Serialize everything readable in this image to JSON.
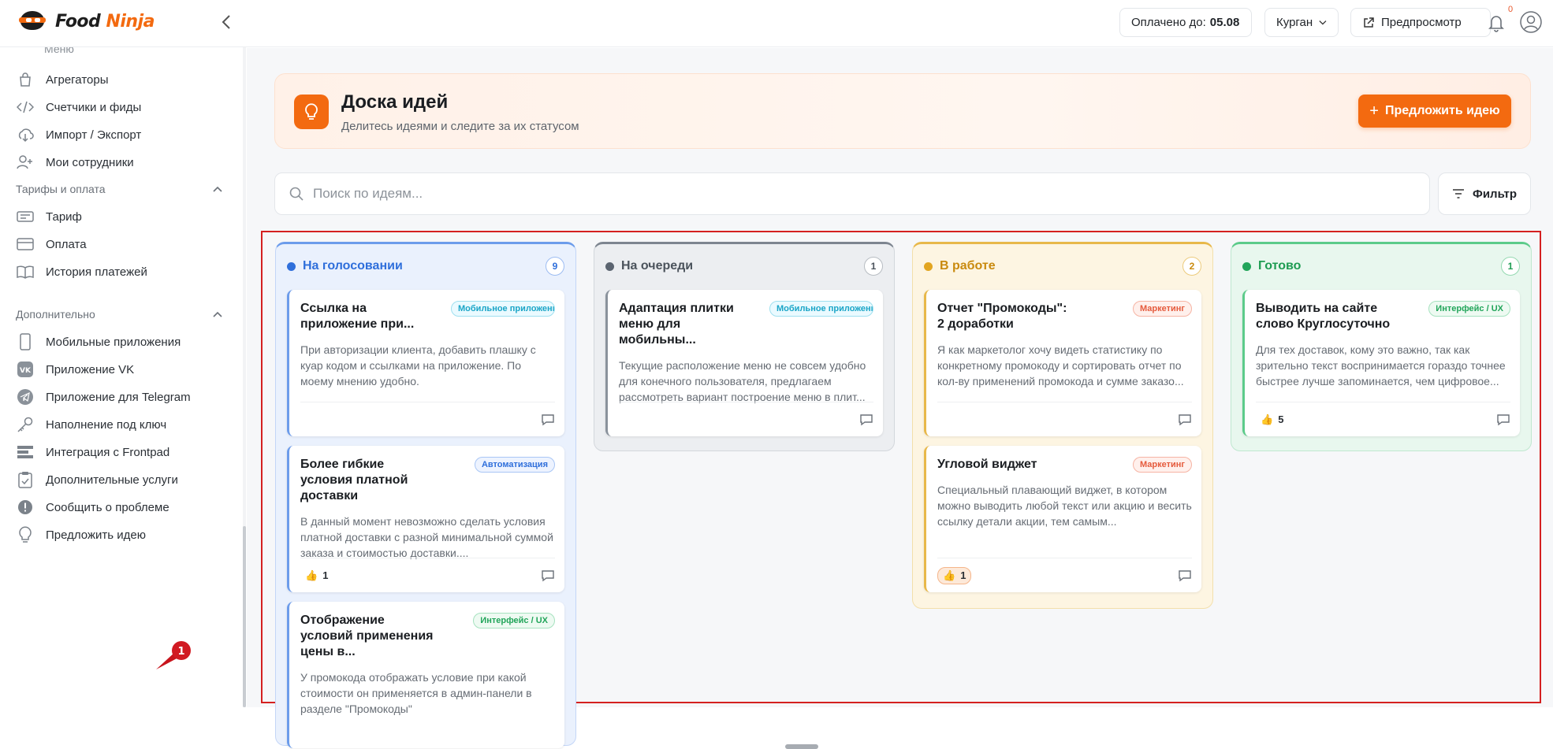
{
  "header": {
    "logo_part1": "Food",
    "logo_part2": "Ninja",
    "paid_label": "Оплачено до:",
    "paid_date": "05.08",
    "city": "Курган",
    "preview_label": "Предпросмотр",
    "notifications_count": "0"
  },
  "sidebar": {
    "cut_item": "Меню",
    "group1": [
      {
        "label": "Агрегаторы",
        "icon": "bag-icon"
      },
      {
        "label": "Счетчики и фиды",
        "icon": "code-icon"
      },
      {
        "label": "Импорт / Экспорт",
        "icon": "cloud-download-icon"
      },
      {
        "label": "Мои сотрудники",
        "icon": "user-plus-icon"
      }
    ],
    "section_tariffs": "Тарифы и оплата",
    "group2": [
      {
        "label": "Тариф",
        "icon": "ticket-icon"
      },
      {
        "label": "Оплата",
        "icon": "card-icon"
      },
      {
        "label": "История платежей",
        "icon": "book-icon"
      }
    ],
    "section_extra": "Дополнительно",
    "group3": [
      {
        "label": "Мобильные приложения",
        "icon": "phone-icon"
      },
      {
        "label": "Приложение VK",
        "icon": "vk-icon"
      },
      {
        "label": "Приложение для Telegram",
        "icon": "telegram-icon"
      },
      {
        "label": "Наполнение под ключ",
        "icon": "key-icon"
      },
      {
        "label": "Интеграция с Frontpad",
        "icon": "frontpad-icon"
      },
      {
        "label": "Дополнительные услуги",
        "icon": "clipboard-icon"
      },
      {
        "label": "Сообщить о проблеме",
        "icon": "alert-icon"
      },
      {
        "label": "Предложить идею",
        "icon": "lightbulb-icon"
      }
    ],
    "pin_number": "1"
  },
  "hero": {
    "title": "Доска идей",
    "subtitle": "Делитесь идеями и следите за их статусом",
    "button": "Предложить идею"
  },
  "search": {
    "placeholder": "Поиск по идеям...",
    "filter_label": "Фильтр"
  },
  "columns": [
    {
      "title": "На голосовании",
      "count": "9",
      "color": "#2f6fdb",
      "cards": [
        {
          "title": "Ссылка на приложение при...",
          "tag": "Мобильное приложение",
          "desc": "При авторизации клиента, добавить плашку с куар кодом и ссылками на приложение. По моему мнению удобно.",
          "likes": ""
        },
        {
          "title": "Более гибкие условия платной доставки",
          "tag": "Автоматизация",
          "desc": "В данный момент невозможно сделать условия платной доставки с разной минимальной суммой заказа и стоимостью доставки....",
          "likes": "1"
        },
        {
          "title": "Отображение условий применения цены в...",
          "tag": "Интерфейс / UX",
          "desc": "У промокода отображать условие при какой стоимости он применяется в админ-панели в разделе \"Промокоды\"",
          "likes": ""
        }
      ]
    },
    {
      "title": "На очереди",
      "count": "1",
      "color": "#5b6470",
      "cards": [
        {
          "title": "Адаптация плитки меню для мобильны...",
          "tag": "Мобильное приложение",
          "desc": "Текущие расположение меню не совсем удобно для конечного пользователя, предлагаем рассмотреть вариант построение меню в плит...",
          "likes": ""
        }
      ]
    },
    {
      "title": "В работе",
      "count": "2",
      "color": "#d99a1c",
      "cards": [
        {
          "title": "Отчет \"Промокоды\": 2 доработки",
          "tag": "Маркетинг",
          "desc": "Я как маркетолог хочу видеть статистику по конкретному промокоду и сортировать отчет по кол-ву применений промокода и сумме заказо...",
          "likes": ""
        },
        {
          "title": "Угловой виджет",
          "tag": "Маркетинг",
          "desc": "Специальный плавающий виджет, в котором можно выводить любой текст или акцию и весить ссылку детали акции, тем самым...",
          "likes": "1"
        }
      ]
    },
    {
      "title": "Готово",
      "count": "1",
      "color": "#22a55a",
      "cards": [
        {
          "title": "Выводить на сайте слово Круглосуточно",
          "tag": "Интерфейс / UX",
          "desc": "Для тех доставок, кому это важно, так как зрительно текст воспринимается гораздо точнее быстрее лучше запоминается, чем цифровое...",
          "likes": "5"
        }
      ]
    }
  ]
}
